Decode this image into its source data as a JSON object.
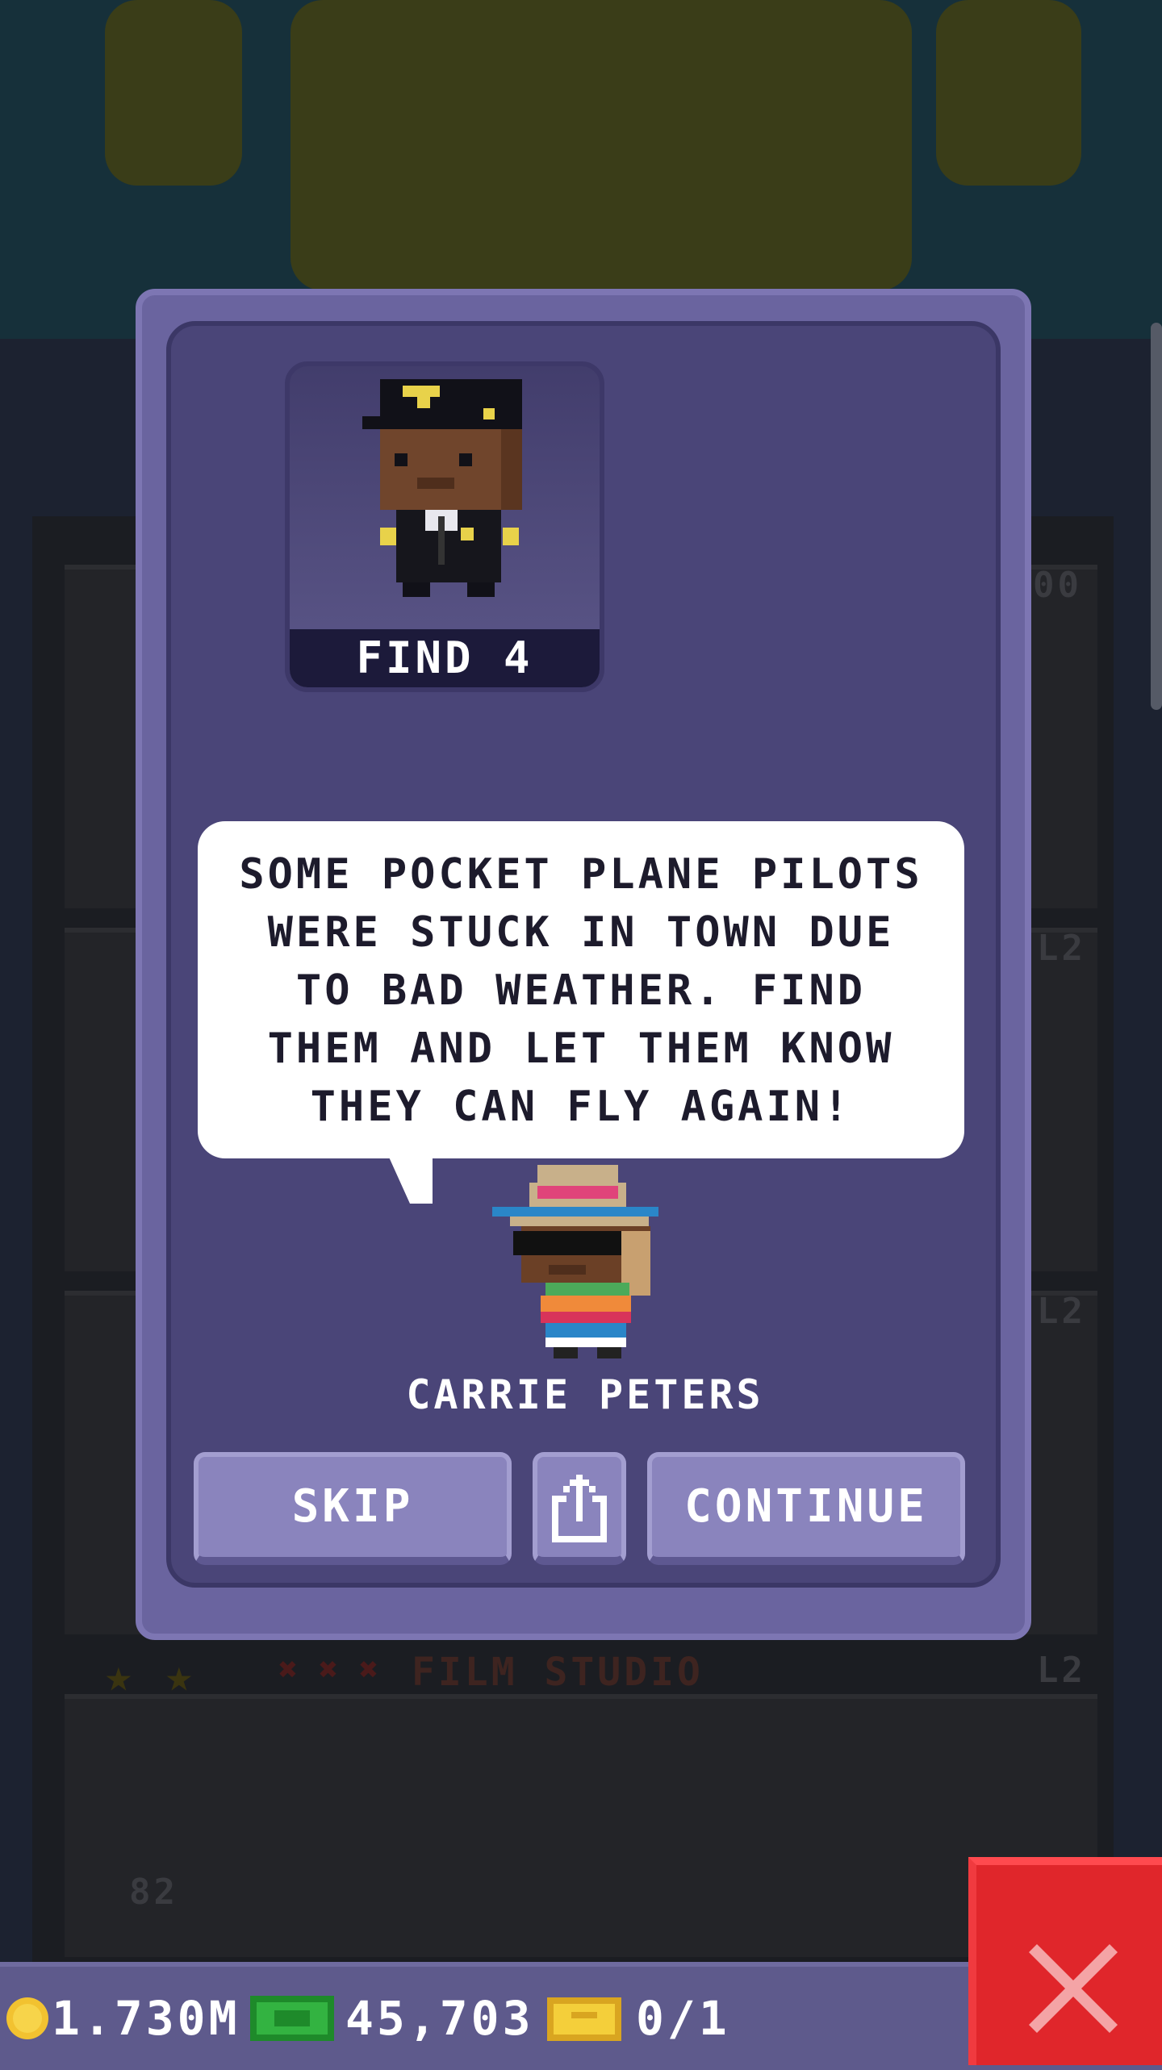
{
  "mission": {
    "find_label": "FIND 4",
    "message": "SOME POCKET PLANE PILOTS WERE STUCK IN TOWN DUE TO BAD WEATHER. FIND THEM AND LET THEM KNOW THEY CAN FLY AGAIN!",
    "message_lines": [
      "SOME POCKET PLANE PILOTS",
      "WERE STUCK IN TOWN DUE",
      "TO BAD WEATHER. FIND",
      "THEM AND LET THEM KNOW",
      "THEY CAN FLY AGAIN!"
    ],
    "speaker_name": "CARRIE PETERS"
  },
  "buttons": {
    "skip_label": "SKIP",
    "continue_label": "CONTINUE",
    "share_icon": "share-icon"
  },
  "background": {
    "floor_name": "FILM STUDIO",
    "level_labels": [
      "L2",
      "L2",
      "L2"
    ],
    "top_number": "00",
    "elevator_number": "82"
  },
  "status_bar": {
    "coins": "1.730M",
    "bux": "45,703",
    "tickets": "0/1"
  },
  "colors": {
    "modal_border": "#6a649f",
    "modal_inner": "#4a4578",
    "button": "#8a84bd",
    "close_button": "#e0262b"
  }
}
